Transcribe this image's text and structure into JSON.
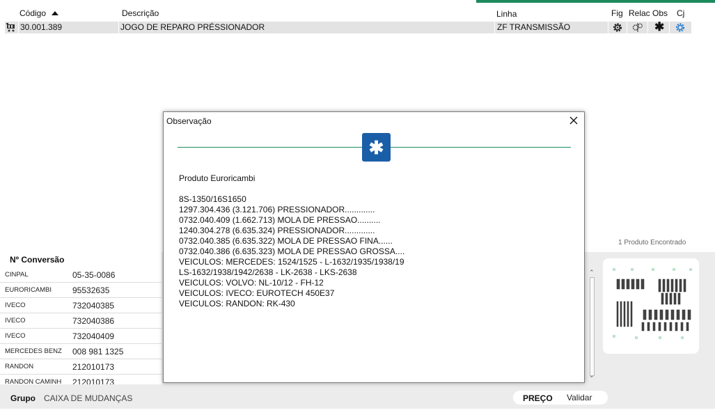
{
  "header": {
    "codigo": "Código",
    "descricao": "Descrição",
    "linha": "Linha",
    "fig": "Fig",
    "relac": "Relac",
    "obs": "Obs",
    "cj": "Cj"
  },
  "product": {
    "codigo": "30.001.389",
    "descricao": "JOGO DE REPARO PRÉSSIONADOR",
    "linha": "ZF TRANSMISSÃO",
    "icons": [
      "cart-icon",
      "gear-icon",
      "relation-icon",
      "asterisk-icon",
      "set-gear-icon"
    ]
  },
  "conversao": {
    "title": "Nº Conversão",
    "rows": [
      {
        "brand": "CINPAL",
        "code": "05-35-0086"
      },
      {
        "brand": "EURORICAMBI",
        "code": "95532635"
      },
      {
        "brand": "IVECO",
        "code": "732040385"
      },
      {
        "brand": "IVECO",
        "code": "732040386"
      },
      {
        "brand": "IVECO",
        "code": "732040409"
      },
      {
        "brand": "MERCEDES BENZ",
        "code": "008 981 1325"
      },
      {
        "brand": "RANDON",
        "code": "212010173"
      },
      {
        "brand": "RANDON CAMINH",
        "code": "212010173"
      }
    ]
  },
  "grupo": {
    "label": "Grupo",
    "value": "CAIXA DE MUDANÇAS"
  },
  "preco": {
    "label": "PREÇO",
    "value": "Validar"
  },
  "found_text": "1 Produto Encontrado",
  "dialog": {
    "title": "Observação",
    "lines": [
      "Produto Euroricambi",
      "",
      "8S-1350/16S1650",
      "1297.304.436 (3.121.706) PRESSIONADOR.............",
      "0732.040.409 (1.662.713) MOLA DE PRESSAO..........",
      "1240.304.278 (6.635.324) PRESSIONADOR.............",
      "0732.040.385 (6.635.322) MOLA DE PRESSAO FINA......",
      "0732.040.386 (6.635.323) MOLA DE PRESSAO GROSSA....",
      "VEICULOS: MERCEDES: 1524/1525 - L-1632/1935/1938/19",
      "LS-1632/1938/1942/2638 - LK-2638 - LKS-2638",
      "VEICULOS: VOLVO: NL-10/12 - FH-12",
      "VEICULOS: IVECO: EUROTECH 450E37",
      "VEICULOS: RANDON: RK-430"
    ]
  },
  "colors": {
    "accent_green": "#1d8a5e",
    "badge_blue": "#1b5ea8",
    "cj_blue": "#2a7fd4"
  }
}
